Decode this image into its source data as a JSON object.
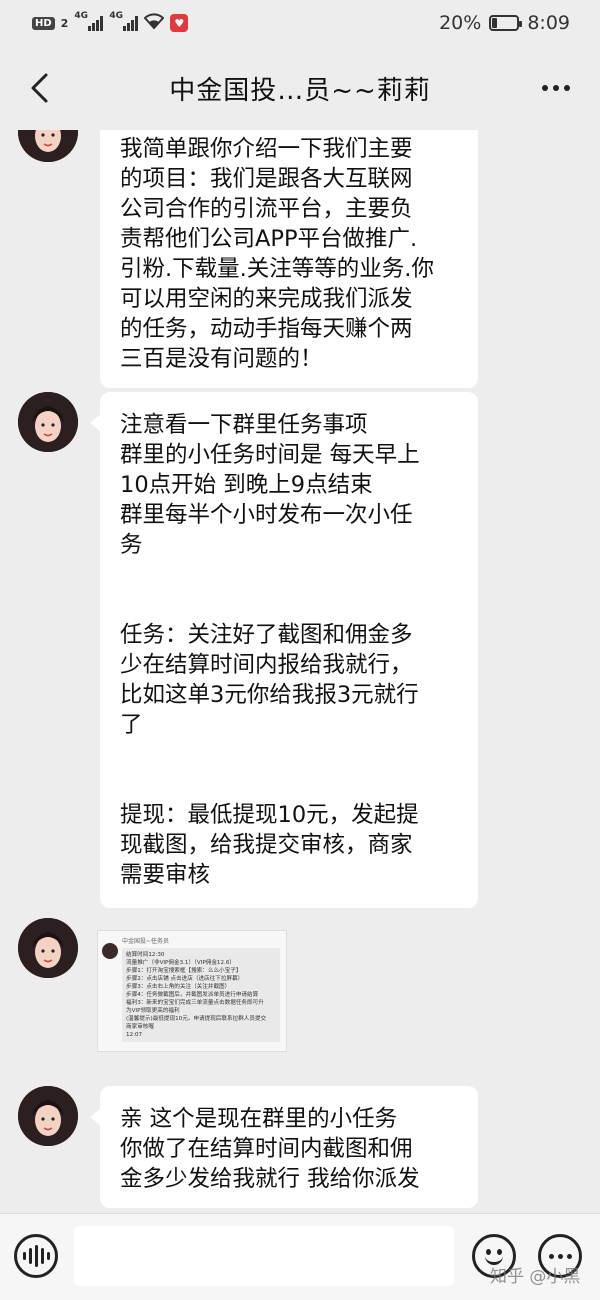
{
  "status_bar": {
    "hd": "HD",
    "sim1": "2",
    "net1": "4G",
    "net2": "4G",
    "battery_percent": "20%",
    "battery_level": 0.2,
    "time": "8:09",
    "icons": [
      "signal-icon",
      "wifi-icon",
      "notification-icon",
      "battery-icon"
    ]
  },
  "header": {
    "back_icon": "back-arrow-icon",
    "title": "中金国投…员~~莉莉",
    "more_icon": "more-dots-icon"
  },
  "messages": [
    {
      "type": "text",
      "lines": [
        "我简单跟你介绍一下我们主要",
        "的项目：我们是跟各大互联网",
        "公司合作的引流平台，主要负",
        "责帮他们公司APP平台做推广.",
        "引粉.下载量.关注等等的业务.你",
        "可以用空闲的来完成我们派发",
        "的任务，动动手指每天赚个两",
        "三百是没有问题的！"
      ]
    },
    {
      "type": "text",
      "lines": [
        "注意看一下群里任务事项",
        "群里的小任务时间是 每天早上",
        "10点开始 到晚上9点结束",
        "群里每半个小时发布一次小任",
        "务",
        "",
        "",
        "任务：关注好了截图和佣金多",
        "少在结算时间内报给我就行，",
        "比如这单3元你给我报3元就行",
        "了",
        "",
        "",
        "提现：最低提现10元，发起提",
        "现截图，给我提交审核，商家",
        "需要审核"
      ]
    },
    {
      "type": "image",
      "mini_title": "中金国投~任务员",
      "mini_lines": [
        "结算时间12:30",
        "流量推广（非VIP佣金3.1）（VIP佣金12.6）",
        "步骤1：打开淘宝搜索框【搜索：么么小宝子】",
        "步骤2：点击店铺  点击进店（进店往下拉屏幕）",
        "步骤3：点击右上角的关注（关注并截图）",
        "步骤4：任务做截图后，并截图发派单员进行申请结算",
        "福利3：新来的宝宝们完成三单流量点击数据任务即可升",
        "为VIP领取更高的福利",
        "(温馨提示)最低提现10元。申请提现后联系拉群人员提交",
        "商家审核喔",
        "12:07"
      ]
    },
    {
      "type": "text",
      "lines": [
        "亲 这个是现在群里的小任务",
        "你做了在结算时间内截图和佣",
        "金多少发给我就行 我给你派发"
      ]
    }
  ],
  "input_bar": {
    "voice_icon": "voice-icon",
    "placeholder": "",
    "emoji_icon": "emoji-icon",
    "more_icon": "more-options-icon"
  },
  "watermark": "知乎 @小黑"
}
